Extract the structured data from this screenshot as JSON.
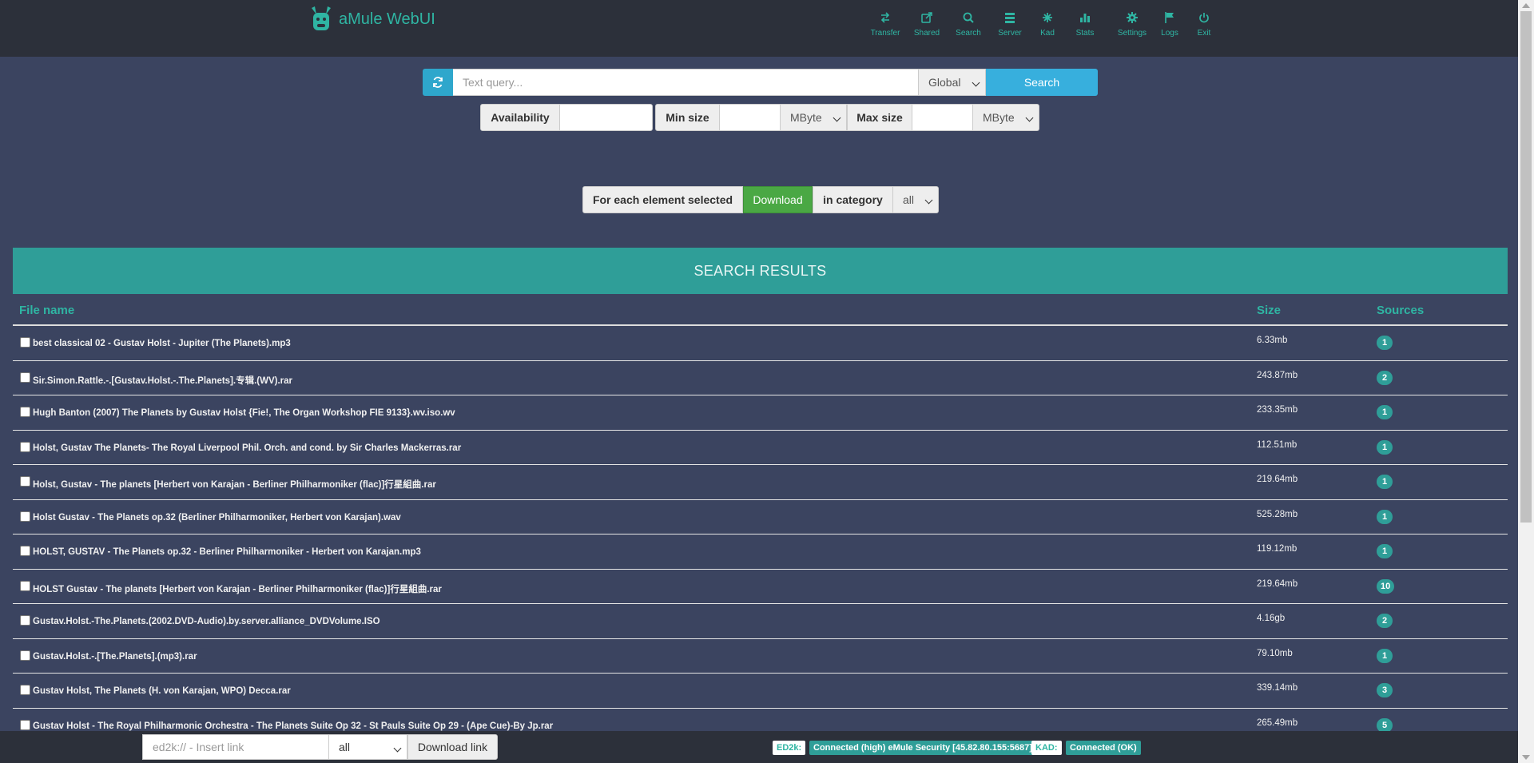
{
  "app": {
    "title": "aMule WebUI"
  },
  "nav": [
    {
      "label": "Transfer",
      "icon": "transfer-icon"
    },
    {
      "label": "Shared",
      "icon": "share-icon"
    },
    {
      "label": "Search",
      "icon": "search-icon"
    },
    {
      "label": "Server",
      "icon": "server-icon"
    },
    {
      "label": "Kad",
      "icon": "kad-icon"
    },
    {
      "label": "Stats",
      "icon": "stats-icon"
    },
    {
      "label": "Settings",
      "icon": "settings-icon"
    },
    {
      "label": "Logs",
      "icon": "flag-icon"
    },
    {
      "label": "Exit",
      "icon": "power-icon"
    }
  ],
  "search": {
    "placeholder": "Text query...",
    "scope": "Global",
    "button": "Search"
  },
  "filters": {
    "availability_label": "Availability",
    "min_size_label": "Min size",
    "min_unit": "MByte",
    "max_size_label": "Max size",
    "max_unit": "MByte"
  },
  "actions": {
    "for_each_label": "For each element selected",
    "download_button": "Download",
    "in_category_label": "in category",
    "category": "all"
  },
  "results": {
    "title": "SEARCH RESULTS",
    "columns": {
      "name": "File name",
      "size": "Size",
      "sources": "Sources"
    },
    "rows": [
      {
        "name": "best classical 02 - Gustav Holst - Jupiter (The Planets).mp3",
        "size": "6.33mb",
        "sources": "1"
      },
      {
        "name": "Sir.Simon.Rattle.-.[Gustav.Holst.-.The.Planets].专辑.(WV).rar",
        "size": "243.87mb",
        "sources": "2"
      },
      {
        "name": "Hugh Banton (2007) The Planets by Gustav Holst {Fie!, The Organ Workshop FIE 9133}.wv.iso.wv",
        "size": "233.35mb",
        "sources": "1"
      },
      {
        "name": "Holst, Gustav The Planets- The Royal Liverpool Phil. Orch. and cond. by Sir Charles Mackerras.rar",
        "size": "112.51mb",
        "sources": "1"
      },
      {
        "name": "Holst, Gustav - The planets [Herbert von Karajan - Berliner Philharmoniker (flac)]行星組曲.rar",
        "size": "219.64mb",
        "sources": "1"
      },
      {
        "name": "Holst Gustav - The Planets op.32 (Berliner Philharmoniker, Herbert von Karajan).wav",
        "size": "525.28mb",
        "sources": "1"
      },
      {
        "name": "HOLST, GUSTAV - The Planets op.32 - Berliner Philharmoniker - Herbert von Karajan.mp3",
        "size": "119.12mb",
        "sources": "1"
      },
      {
        "name": "HOLST Gustav - The planets [Herbert von Karajan - Berliner Philharmoniker (flac)]行星組曲.rar",
        "size": "219.64mb",
        "sources": "10"
      },
      {
        "name": "Gustav.Holst.-The.Planets.(2002.DVD-Audio).by.server.alliance_DVDVolume.ISO",
        "size": "4.16gb",
        "sources": "2"
      },
      {
        "name": "Gustav.Holst.-.[The.Planets].(mp3).rar",
        "size": "79.10mb",
        "sources": "1"
      },
      {
        "name": "Gustav Holst, The Planets (H. von Karajan, WPO) Decca.rar",
        "size": "339.14mb",
        "sources": "3"
      },
      {
        "name": "Gustav Holst - The Royal Philharmonic Orchestra - The Planets Suite Op 32 - St Pauls Suite Op 29 - (Ape Cue)-By Jp.rar",
        "size": "265.49mb",
        "sources": "5"
      }
    ]
  },
  "footer": {
    "link_placeholder": "ed2k:// - Insert link",
    "category": "all",
    "download_link_button": "Download link",
    "ed2k_label": "ED2k:",
    "ed2k_status": "Connected (high) eMule Security [45.82.80.155:5687]",
    "kad_label": "KAD:",
    "kad_status": "Connected (OK)"
  },
  "colors": {
    "accent": "#2fb5a3",
    "background": "#3b4460",
    "bar": "#2c303a",
    "download": "#4aa844",
    "search": "#37afdd"
  }
}
